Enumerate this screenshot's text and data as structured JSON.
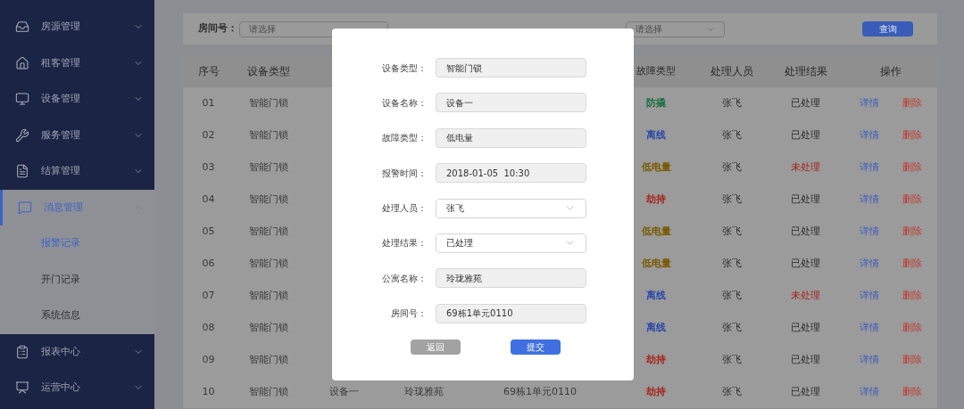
{
  "sidebar": {
    "items": [
      {
        "label": "房源管理",
        "selected": false,
        "expanded": false
      },
      {
        "label": "租客管理",
        "selected": false,
        "expanded": false
      },
      {
        "label": "设备管理",
        "selected": false,
        "expanded": false
      },
      {
        "label": "服务管理",
        "selected": false,
        "expanded": false
      },
      {
        "label": "结算管理",
        "selected": false,
        "expanded": false
      },
      {
        "label": "消息管理",
        "selected": true,
        "expanded": true,
        "children": [
          {
            "label": "报警记录",
            "selected": true
          },
          {
            "label": "开门记录",
            "selected": false
          },
          {
            "label": "系统信息",
            "selected": false
          }
        ]
      },
      {
        "label": "报表中心",
        "selected": false,
        "expanded": false
      },
      {
        "label": "运营中心",
        "selected": false,
        "expanded": false
      }
    ]
  },
  "filter": {
    "room_label": "房间号：",
    "room_placeholder": "请选择",
    "result_placeholder": "请选择",
    "search_button": "查询"
  },
  "table": {
    "columns": [
      "序号",
      "设备类型",
      "",
      "",
      "",
      "故障类型",
      "处理人员",
      "处理结果",
      "操作"
    ],
    "rows": [
      {
        "index": "01",
        "device_type": "智能门锁",
        "fault": {
          "text": "防撬",
          "color": "#17703e"
        },
        "handler": "张飞",
        "result": "已处理",
        "pending": false,
        "actions": [
          "详情",
          "删除"
        ]
      },
      {
        "index": "02",
        "device_type": "智能门锁",
        "fault": {
          "text": "离线",
          "color": "#2b4aa8"
        },
        "handler": "张飞",
        "result": "已处理",
        "pending": false,
        "actions": [
          "详情",
          "删除"
        ]
      },
      {
        "index": "03",
        "device_type": "智能门锁",
        "fault": {
          "text": "低电量",
          "color": "#7a5a00"
        },
        "handler": "张飞",
        "result": "未处理",
        "pending": true,
        "actions": [
          "详情",
          "删除"
        ]
      },
      {
        "index": "04",
        "device_type": "智能门锁",
        "fault": {
          "text": "劫持",
          "color": "#a52518"
        },
        "handler": "张飞",
        "result": "已处理",
        "pending": false,
        "actions": [
          "详情",
          "删除"
        ]
      },
      {
        "index": "05",
        "device_type": "智能门锁",
        "fault": {
          "text": "低电量",
          "color": "#7a5a00"
        },
        "handler": "张飞",
        "result": "已处理",
        "pending": false,
        "actions": [
          "详情",
          "删除"
        ]
      },
      {
        "index": "06",
        "device_type": "智能门锁",
        "fault": {
          "text": "低电量",
          "color": "#7a5a00"
        },
        "handler": "张飞",
        "result": "已处理",
        "pending": false,
        "actions": [
          "详情",
          "删除"
        ]
      },
      {
        "index": "07",
        "device_type": "智能门锁",
        "fault": {
          "text": "离线",
          "color": "#2b4aa8"
        },
        "handler": "张飞",
        "result": "未处理",
        "pending": true,
        "actions": [
          "详情",
          "删除"
        ]
      },
      {
        "index": "08",
        "device_type": "智能门锁",
        "fault": {
          "text": "离线",
          "color": "#2b4aa8"
        },
        "handler": "张飞",
        "result": "已处理",
        "pending": false,
        "actions": [
          "详情",
          "删除"
        ]
      },
      {
        "index": "09",
        "device_type": "智能门锁",
        "fault": {
          "text": "劫持",
          "color": "#a52518"
        },
        "handler": "张飞",
        "result": "已处理",
        "pending": false,
        "actions": [
          "详情",
          "删除"
        ]
      },
      {
        "index": "10",
        "device_type": "智能门锁",
        "device_name": "设备一",
        "apartment": "玲珑雅苑",
        "room": "69栋1单元0110",
        "fault": {
          "text": "劫持",
          "color": "#a52518"
        },
        "handler": "张飞",
        "result": "已处理",
        "pending": false,
        "actions": [
          "详情",
          "删除"
        ]
      }
    ]
  },
  "dialog": {
    "fields": [
      {
        "label": "设备类型：",
        "value": "智能门锁",
        "kind": "text"
      },
      {
        "label": "设备名称：",
        "value": "设备一",
        "kind": "text"
      },
      {
        "label": "故障类型：",
        "value": "低电量",
        "kind": "text"
      },
      {
        "label": "报警时间：",
        "value": "2018-01-05  10:30",
        "kind": "text"
      },
      {
        "label": "处理人员：",
        "value": "张飞",
        "kind": "select"
      },
      {
        "label": "处理结果：",
        "value": "已处理",
        "kind": "select"
      },
      {
        "label": "公寓名称：",
        "value": "玲珑雅苑",
        "kind": "text"
      },
      {
        "label": "房间号：",
        "value": "69栋1单元0110",
        "kind": "text"
      }
    ],
    "buttons": [
      {
        "label": "返回",
        "disabled": true
      },
      {
        "label": "提交",
        "disabled": false
      }
    ]
  }
}
